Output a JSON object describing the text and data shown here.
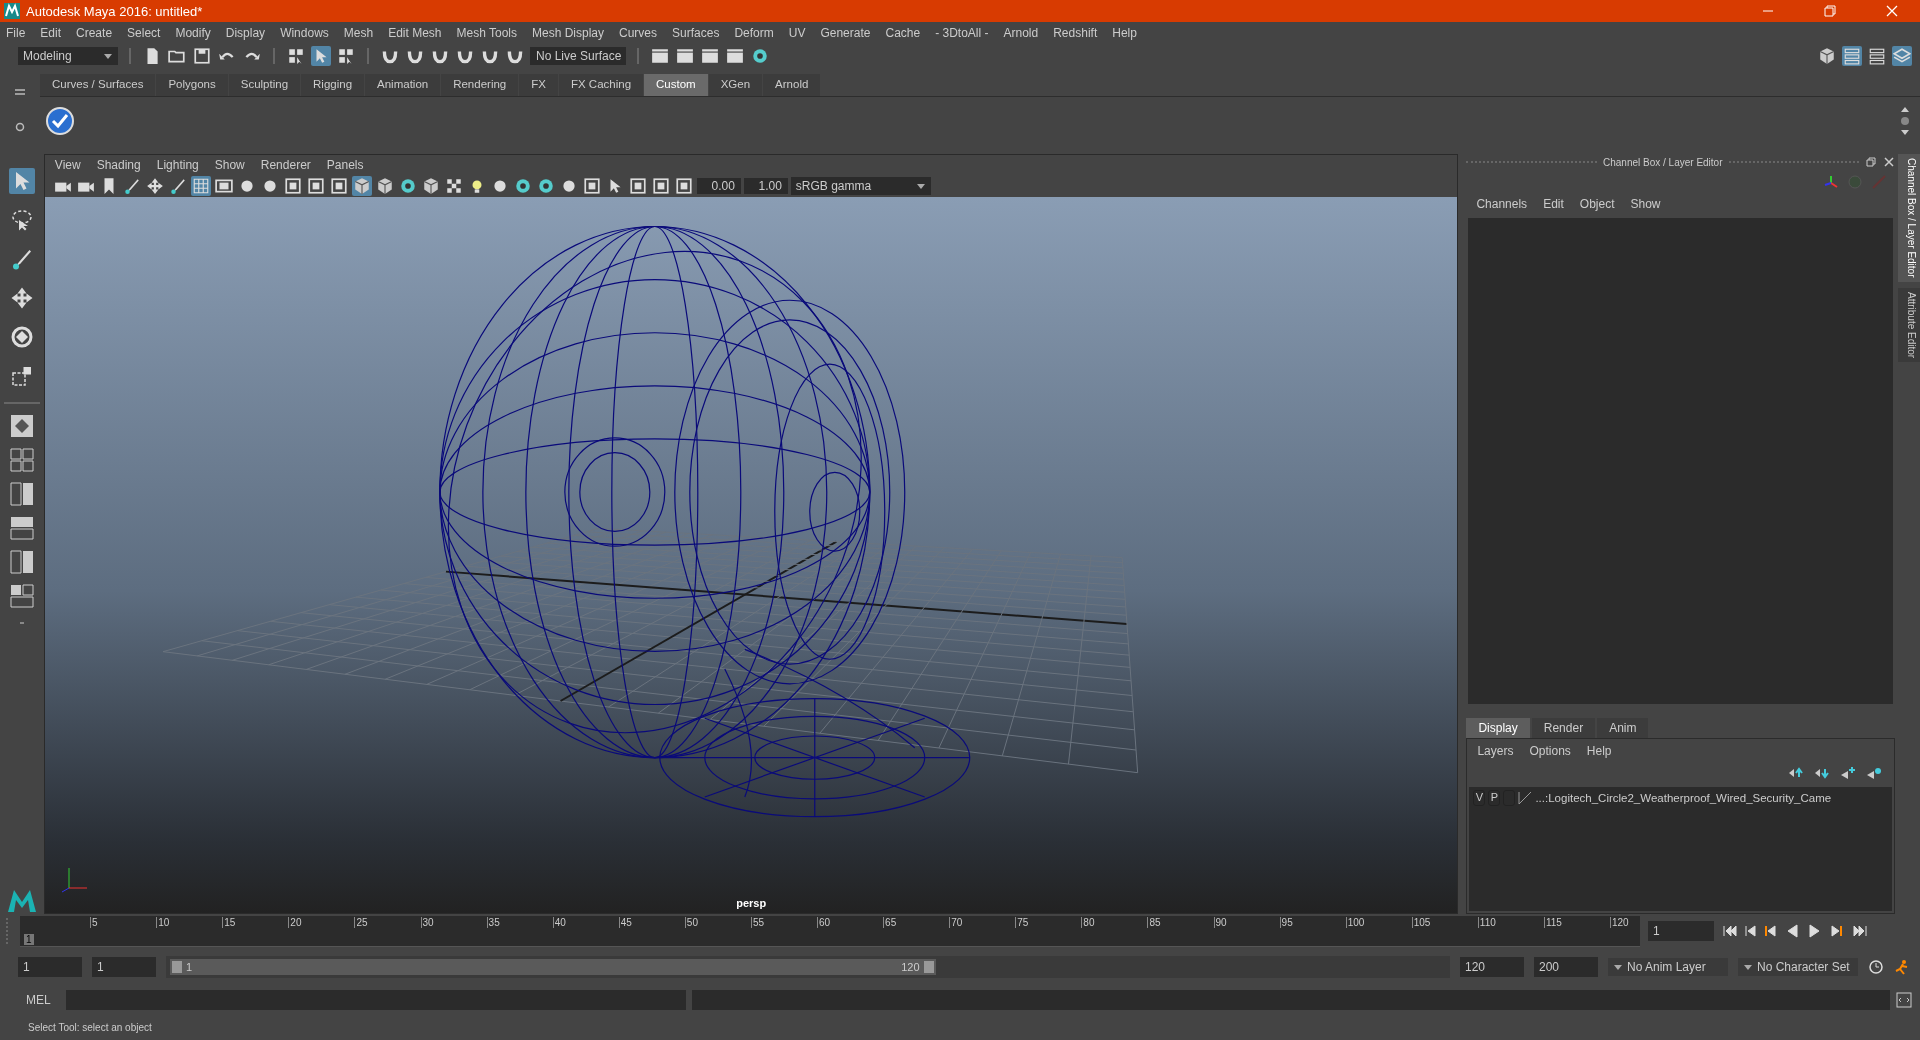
{
  "window": {
    "title": "Autodesk Maya 2016: untitled*"
  },
  "menu_bar": [
    "File",
    "Edit",
    "Create",
    "Select",
    "Modify",
    "Display",
    "Windows",
    "Mesh",
    "Edit Mesh",
    "Mesh Tools",
    "Mesh Display",
    "Curves",
    "Surfaces",
    "Deform",
    "UV",
    "Generate",
    "Cache",
    "- 3DtoAll -",
    "Arnold",
    "Redshift",
    "Help"
  ],
  "status_line": {
    "mode": "Modeling",
    "live_surface": "No Live Surface",
    "icons": [
      {
        "kind": "document",
        "selected": false
      },
      {
        "kind": "folder",
        "selected": false
      },
      {
        "kind": "disk",
        "selected": false
      },
      {
        "kind": "undo",
        "selected": false
      },
      {
        "kind": "redo",
        "selected": false
      },
      {
        "kind": "hierarchy",
        "selected": false
      },
      {
        "kind": "pick",
        "selected": true
      },
      {
        "kind": "component",
        "selected": false
      },
      {
        "kind": "magnet",
        "selected": false
      },
      {
        "kind": "magnet",
        "selected": false
      },
      {
        "kind": "magnet",
        "selected": false
      },
      {
        "kind": "magnet",
        "selected": false
      },
      {
        "kind": "magnet",
        "selected": false
      },
      {
        "kind": "magnet",
        "selected": false
      }
    ],
    "render_icons": [
      {
        "kind": "clapper",
        "selected": false
      },
      {
        "kind": "clapper",
        "selected": false
      },
      {
        "kind": "clapper",
        "selected": false
      },
      {
        "kind": "clapper",
        "selected": false
      },
      {
        "kind": "sphere",
        "selected": false
      }
    ],
    "panel_icons": [
      {
        "kind": "cube",
        "selected": false
      },
      {
        "kind": "sliders",
        "selected": true
      },
      {
        "kind": "list",
        "selected": false
      },
      {
        "kind": "layers",
        "selected": true
      }
    ]
  },
  "shelf": {
    "tabs": [
      {
        "label": "Curves / Surfaces",
        "selected": false
      },
      {
        "label": "Polygons",
        "selected": false
      },
      {
        "label": "Sculpting",
        "selected": false
      },
      {
        "label": "Rigging",
        "selected": false
      },
      {
        "label": "Animation",
        "selected": false
      },
      {
        "label": "Rendering",
        "selected": false
      },
      {
        "label": "FX",
        "selected": false
      },
      {
        "label": "FX Caching",
        "selected": false
      },
      {
        "label": "Custom",
        "selected": true
      },
      {
        "label": "XGen",
        "selected": false
      },
      {
        "label": "Arnold",
        "selected": false
      }
    ]
  },
  "toolbox": [
    {
      "kind": "arrow",
      "selected": true
    },
    {
      "kind": "lasso",
      "selected": false
    },
    {
      "kind": "brush",
      "selected": false
    },
    {
      "kind": "move",
      "selected": false
    },
    {
      "kind": "rotate",
      "selected": false
    },
    {
      "kind": "scale",
      "selected": false
    }
  ],
  "viewport": {
    "menu": [
      "View",
      "Shading",
      "Lighting",
      "Show",
      "Renderer",
      "Panels"
    ],
    "icons": [
      {
        "kind": "camera",
        "selected": false
      },
      {
        "kind": "camera",
        "selected": false
      },
      {
        "kind": "bookmark",
        "selected": false
      },
      {
        "kind": "brush",
        "selected": false
      },
      {
        "kind": "move",
        "selected": false
      },
      {
        "kind": "brush",
        "selected": false
      },
      {
        "kind": "grid",
        "selected": true
      },
      {
        "kind": "film",
        "selected": false
      },
      {
        "kind": "circle",
        "selected": false
      },
      {
        "kind": "circle",
        "selected": false
      },
      {
        "kind": "square",
        "selected": false
      },
      {
        "kind": "square",
        "selected": false
      },
      {
        "kind": "square",
        "selected": false
      },
      {
        "kind": "cube",
        "selected": true
      },
      {
        "kind": "cube",
        "selected": false
      },
      {
        "kind": "sphere",
        "selected": false
      },
      {
        "kind": "cube",
        "selected": false
      },
      {
        "kind": "checker",
        "selected": false
      },
      {
        "kind": "light",
        "selected": false
      },
      {
        "kind": "circle",
        "selected": false
      },
      {
        "kind": "sphere",
        "selected": false
      },
      {
        "kind": "sphere",
        "selected": false
      },
      {
        "kind": "circle",
        "selected": false
      },
      {
        "kind": "square",
        "selected": false
      },
      {
        "kind": "pick",
        "selected": false
      },
      {
        "kind": "square",
        "selected": false
      },
      {
        "kind": "square",
        "selected": false
      },
      {
        "kind": "square",
        "selected": false
      }
    ],
    "exposure": "0.00",
    "gamma": "1.00",
    "color_space": "sRGB gamma",
    "camera_label": "persp"
  },
  "channel_box": {
    "title": "Channel Box / Layer Editor",
    "menu": [
      "Channels",
      "Edit",
      "Object",
      "Show"
    ]
  },
  "layer_editor": {
    "tabs": [
      {
        "label": "Display",
        "selected": true
      },
      {
        "label": "Render",
        "selected": false
      },
      {
        "label": "Anim",
        "selected": false
      }
    ],
    "menu": [
      "Layers",
      "Options",
      "Help"
    ],
    "layers": [
      {
        "visible": "V",
        "playback": "P",
        "name": "...:Logitech_Circle2_Weatherproof_Wired_Security_Came"
      }
    ]
  },
  "side_tabs": [
    {
      "label": "Channel Box / Layer Editor",
      "selected": true
    },
    {
      "label": "Attribute Editor",
      "selected": false
    }
  ],
  "timeline": {
    "ticks": [
      "5",
      "10",
      "15",
      "20",
      "25",
      "30",
      "35",
      "40",
      "45",
      "50",
      "55",
      "60",
      "65",
      "70",
      "75",
      "80",
      "85",
      "90",
      "95",
      "100",
      "105",
      "110",
      "115",
      "120"
    ],
    "current_frame": "1",
    "level": 0,
    "frame_field": "1"
  },
  "range": {
    "start": "1",
    "playback_start": "1",
    "slider_start": "1",
    "slider_end": "120",
    "level": 0.6,
    "playback_end": "120",
    "end": "200",
    "anim_layer": "No Anim Layer",
    "character_set": "No Character Set"
  },
  "command_line": {
    "label": "MEL"
  },
  "help_line": "Select Tool: select an object"
}
